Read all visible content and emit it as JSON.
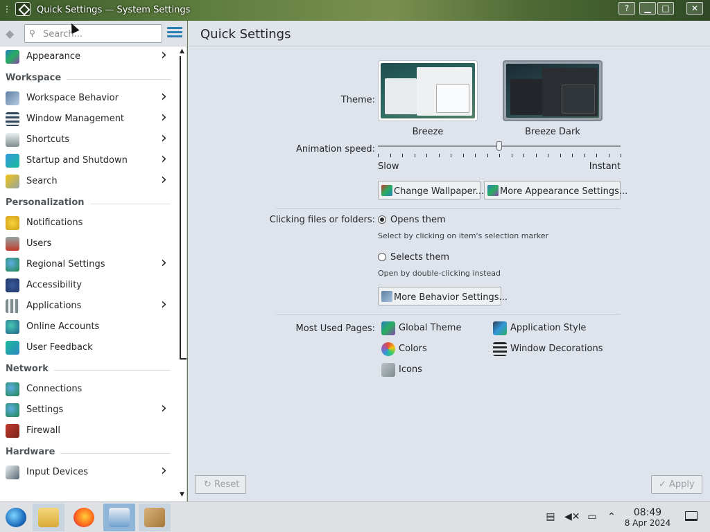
{
  "window": {
    "title": "Quick Settings — System Settings",
    "buttons": {
      "help": "?",
      "minimize": "▁",
      "maximize": "□",
      "close": "✕"
    }
  },
  "sidebar": {
    "search_placeholder": "Search...",
    "items": [
      {
        "label": "Appearance",
        "icon": "appearance-icon",
        "has_children": true
      },
      {
        "section": "Workspace"
      },
      {
        "label": "Workspace Behavior",
        "icon": "workspace-behavior-icon",
        "has_children": true
      },
      {
        "label": "Window Management",
        "icon": "window-management-icon",
        "has_children": true
      },
      {
        "label": "Shortcuts",
        "icon": "keyboard-icon",
        "has_children": true
      },
      {
        "label": "Startup and Shutdown",
        "icon": "startup-icon",
        "has_children": true
      },
      {
        "label": "Search",
        "icon": "search-icon",
        "has_children": true
      },
      {
        "section": "Personalization"
      },
      {
        "label": "Notifications",
        "icon": "bell-icon",
        "has_children": false
      },
      {
        "label": "Users",
        "icon": "users-icon",
        "has_children": false
      },
      {
        "label": "Regional Settings",
        "icon": "globe-icon",
        "has_children": true
      },
      {
        "label": "Accessibility",
        "icon": "accessibility-icon",
        "has_children": false
      },
      {
        "label": "Applications",
        "icon": "applications-icon",
        "has_children": true
      },
      {
        "label": "Online Accounts",
        "icon": "online-accounts-icon",
        "has_children": false
      },
      {
        "label": "User Feedback",
        "icon": "feedback-icon",
        "has_children": false
      },
      {
        "section": "Network"
      },
      {
        "label": "Connections",
        "icon": "network-icon",
        "has_children": false
      },
      {
        "label": "Settings",
        "icon": "network-settings-icon",
        "has_children": true
      },
      {
        "label": "Firewall",
        "icon": "firewall-icon",
        "has_children": false
      },
      {
        "section": "Hardware"
      },
      {
        "label": "Input Devices",
        "icon": "mouse-icon",
        "has_children": true
      }
    ]
  },
  "main": {
    "title": "Quick Settings",
    "theme": {
      "label": "Theme:",
      "options": [
        {
          "name": "Breeze",
          "selected": false
        },
        {
          "name": "Breeze Dark",
          "selected": true
        }
      ]
    },
    "animation": {
      "label": "Animation speed:",
      "min_label": "Slow",
      "max_label": "Instant",
      "value_fraction": 0.5
    },
    "buttons": {
      "change_wallpaper": "Change Wallpaper...",
      "more_appearance": "More Appearance Settings...",
      "more_behavior": "More Behavior Settings..."
    },
    "clicking": {
      "label": "Clicking files or folders:",
      "options": [
        {
          "label": "Opens them",
          "hint": "Select by clicking on item's selection marker",
          "checked": true
        },
        {
          "label": "Selects them",
          "hint": "Open by double-clicking instead",
          "checked": false
        }
      ]
    },
    "most_used": {
      "label": "Most Used Pages:",
      "pages": [
        {
          "label": "Global Theme",
          "icon": "global-theme-icon"
        },
        {
          "label": "Application Style",
          "icon": "application-style-icon"
        },
        {
          "label": "Colors",
          "icon": "colors-icon"
        },
        {
          "label": "Window Decorations",
          "icon": "window-decorations-icon"
        },
        {
          "label": "Icons",
          "icon": "icons-icon"
        }
      ]
    },
    "footer": {
      "reset": "Reset",
      "apply": "Apply"
    }
  },
  "taskbar": {
    "apps": [
      "start-menu",
      "file-manager",
      "firefox",
      "system-settings",
      "package-installer"
    ],
    "clock_time": "08:49",
    "clock_date": "8 Apr 2024"
  },
  "colors": {
    "accent": "#2980b9",
    "sidebar_bg": "#ffffff",
    "content_bg": "#dee3ec"
  }
}
